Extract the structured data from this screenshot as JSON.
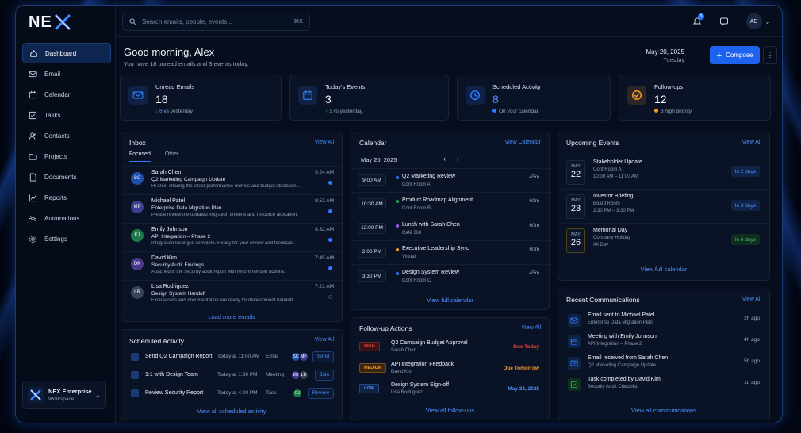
{
  "brand": {
    "logo_text": "NE",
    "workspace_name": "NEX Enterprise",
    "workspace_sub": "Workspace"
  },
  "nav": [
    {
      "label": "Dashboard",
      "icon": "home-icon",
      "active": true
    },
    {
      "label": "Email",
      "icon": "mail-icon"
    },
    {
      "label": "Calendar",
      "icon": "calendar-icon"
    },
    {
      "label": "Tasks",
      "icon": "tasks-icon"
    },
    {
      "label": "Contacts",
      "icon": "contacts-icon"
    },
    {
      "label": "Projects",
      "icon": "folder-icon"
    },
    {
      "label": "Documents",
      "icon": "document-icon"
    },
    {
      "label": "Reports",
      "icon": "chart-icon"
    },
    {
      "label": "Automations",
      "icon": "automation-icon"
    },
    {
      "label": "Settings",
      "icon": "gear-icon"
    }
  ],
  "topbar": {
    "search_placeholder": "Search emails, people, events...",
    "shortcut": "⌘K",
    "notif_count": "3",
    "avatar": "AD"
  },
  "header": {
    "greeting": "Good morning, Alex",
    "subtitle": "You have 18 unread emails and 3 events today.",
    "date": "May 20, 2025",
    "day": "Tuesday",
    "compose_label": "Compose"
  },
  "stats": [
    {
      "label": "Unread Emails",
      "value": "18",
      "arrow": "↓",
      "change": "6",
      "sub": " vs yesterday",
      "color": "#2d7bff",
      "icon": "mail-icon"
    },
    {
      "label": "Today's Events",
      "value": "3",
      "arrow": "↑",
      "change": "1",
      "sub": " vs yesterday",
      "color": "#2d7bff",
      "icon": "calendar-icon"
    },
    {
      "label": "Scheduled Activity",
      "value": "8",
      "sub": "On your calendar",
      "color": "#2d7bff",
      "icon": "clock-icon"
    },
    {
      "label": "Follow-ups",
      "value": "12",
      "sub": "3 high priority",
      "color": "#f39a2b",
      "icon": "check-circle-icon"
    }
  ],
  "inbox": {
    "title": "Inbox",
    "view_all": "View All",
    "tabs": [
      "Focused",
      "Other"
    ],
    "load_more": "Load more emails",
    "emails": [
      {
        "initials": "SC",
        "name": "Sarah Chen",
        "subject": "Q2 Marketing Campaign Update",
        "preview": "Hi Alex, sharing the latest performance metrics and budget utilization...",
        "time": "9:24 AM",
        "unread": true,
        "color": "#1f4fa8"
      },
      {
        "initials": "MP",
        "name": "Michael Patel",
        "subject": "Enterprise Data Migration Plan",
        "preview": "Please review the updated migration timeline and resource allocation.",
        "time": "8:51 AM",
        "unread": true,
        "color": "#3a3f8f"
      },
      {
        "initials": "EJ",
        "name": "Emily Johnson",
        "subject": "API Integration – Phase 2",
        "preview": "Integration testing is complete. Ready for your review and feedback.",
        "time": "8:32 AM",
        "unread": true,
        "color": "#1f7a4a"
      },
      {
        "initials": "DK",
        "name": "David Kim",
        "subject": "Security Audit Findings",
        "preview": "Attached is the security audit report with recommended actions.",
        "time": "7:45 AM",
        "unread": true,
        "color": "#4a3a8f"
      },
      {
        "initials": "LR",
        "name": "Lisa Rodriguez",
        "subject": "Design System Handoff",
        "preview": "Final assets and documentation are ready for development handoff.",
        "time": "7:21 AM",
        "unread": false,
        "color": "#3a4458"
      }
    ]
  },
  "scheduled": {
    "title": "Scheduled Activity",
    "view_all": "View All",
    "footer": "View all scheduled activity",
    "items": [
      {
        "title": "Send Q2 Campaign Report",
        "time": "Today at 11:00 AM",
        "type": "Email",
        "avatars": [
          "SC",
          "MP"
        ],
        "action": "Send"
      },
      {
        "title": "1:1 with Design Team",
        "time": "Today at 1:30 PM",
        "type": "Meeting",
        "avatars": [
          "DK",
          "LR"
        ],
        "action": "Join"
      },
      {
        "title": "Review Security Report",
        "time": "Today at 4:00 PM",
        "type": "Task",
        "avatars": [
          "EJ"
        ],
        "action": "Review"
      }
    ]
  },
  "calendar": {
    "title": "Calendar",
    "view": "View Calendar",
    "date": "May 20, 2025",
    "footer": "View full calendar",
    "events": [
      {
        "time": "9:00 AM",
        "title": "Q2 Marketing Review",
        "loc": "Conf Room A",
        "dur": "45m",
        "color": "#2d7bff"
      },
      {
        "time": "10:30 AM",
        "title": "Product Roadmap Alignment",
        "loc": "Conf Room B",
        "dur": "60m",
        "color": "#22b357"
      },
      {
        "time": "12:00 PM",
        "title": "Lunch with Sarah Chen",
        "loc": "Café 360",
        "dur": "60m",
        "color": "#9a5cf0"
      },
      {
        "time": "2:00 PM",
        "title": "Executive Leadership Sync",
        "loc": "Virtual",
        "dur": "60m",
        "color": "#f39a2b"
      },
      {
        "time": "3:30 PM",
        "title": "Design System Review",
        "loc": "Conf Room C",
        "dur": "45m",
        "color": "#2d7bff"
      }
    ]
  },
  "followups": {
    "title": "Follow-up Actions",
    "view_all": "View All",
    "footer": "View all follow-ups",
    "items": [
      {
        "prio": "HIGH",
        "title": "Q2 Campaign Budget Approval",
        "who": "Sarah Chen",
        "due": "Due Today",
        "prio_color": "#e0483e",
        "prio_bg": "#3a1318",
        "due_color": "#e0483e"
      },
      {
        "prio": "MEDIUM",
        "title": "API Integration Feedback",
        "who": "David Kim",
        "due": "Due Tomorrow",
        "prio_color": "#f39a2b",
        "prio_bg": "#3a2610",
        "due_color": "#f39a2b"
      },
      {
        "prio": "LOW",
        "title": "Design System Sign-off",
        "who": "Lisa Rodriguez",
        "due": "May 23, 2025",
        "prio_color": "#4d8fff",
        "prio_bg": "#0f2346",
        "due_color": "#4d8fff"
      }
    ]
  },
  "upcoming": {
    "title": "Upcoming Events",
    "view_all": "View All",
    "footer": "View full calendar",
    "items": [
      {
        "mon": "MAY",
        "day": "22",
        "title": "Stakeholder Update",
        "sub": "Conf Room A",
        "sub2": "10:00 AM – 11:00 AM",
        "badge": "In 2 days",
        "badge_color": "#4d8fff",
        "badge_bg": "#0f2346"
      },
      {
        "mon": "MAY",
        "day": "23",
        "title": "Investor Briefing",
        "sub": "Board Room",
        "sub2": "2:30 PM – 3:30 PM",
        "badge": "In 3 days",
        "badge_color": "#4d8fff",
        "badge_bg": "#0f2346"
      },
      {
        "mon": "MAY",
        "day": "26",
        "title": "Memorial Day",
        "sub": "Company Holiday",
        "sub2": "All Day",
        "badge": "In 6 days",
        "badge_color": "#35c46a",
        "badge_bg": "#0f2e1d"
      }
    ]
  },
  "recent": {
    "title": "Recent Communications",
    "view_all": "View All",
    "footer": "View all communications",
    "items": [
      {
        "title": "Email sent to Michael Patel",
        "sub": "Enterprise Data Migration Plan",
        "time": "2h ago",
        "icon": "mail-icon",
        "color": "#2d7bff",
        "bg": "#0f2346"
      },
      {
        "title": "Meeting with Emily Johnson",
        "sub": "API Integration – Phase 2",
        "time": "4h ago",
        "icon": "calendar-icon",
        "color": "#2d7bff",
        "bg": "#0f2346"
      },
      {
        "title": "Email received from Sarah Chen",
        "sub": "Q2 Marketing Campaign Update",
        "time": "5h ago",
        "icon": "mail-icon",
        "color": "#2d7bff",
        "bg": "#0f2346"
      },
      {
        "title": "Task completed by David Kim",
        "sub": "Security Audit Checklist",
        "time": "1d ago",
        "icon": "check-icon",
        "color": "#35c46a",
        "bg": "#0f2e1d"
      }
    ]
  }
}
